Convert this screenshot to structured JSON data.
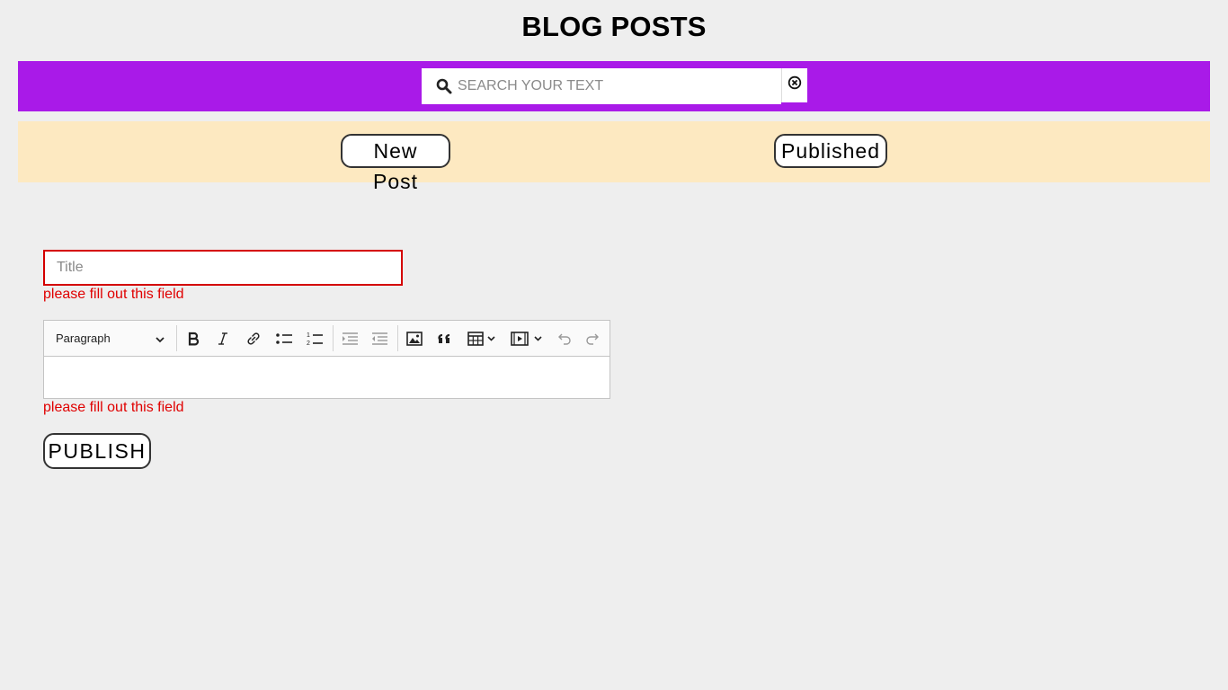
{
  "header": {
    "title": "BLOG POSTS"
  },
  "search": {
    "placeholder": "SEARCH YOUR TEXT",
    "value": ""
  },
  "colors": {
    "search_bar": "#a91ae8",
    "nav_band": "#fde9c1",
    "error": "#e00000",
    "background": "#eeeeee"
  },
  "nav": {
    "new_post_label": "New Post",
    "published_label": "Published"
  },
  "form": {
    "title_placeholder": "Title",
    "title_value": "",
    "title_error": "please fill out this field",
    "editor": {
      "paragraph_style": "Paragraph",
      "content": "",
      "tools": [
        "bold-icon",
        "italic-icon",
        "link-icon",
        "bulleted-list-icon",
        "numbered-list-icon",
        "indent-icon",
        "outdent-icon",
        "image-icon",
        "quote-icon",
        "table-icon",
        "media-icon",
        "undo-icon",
        "redo-icon"
      ]
    },
    "content_error": "please fill out this field",
    "publish_label": "PUBLISH"
  }
}
